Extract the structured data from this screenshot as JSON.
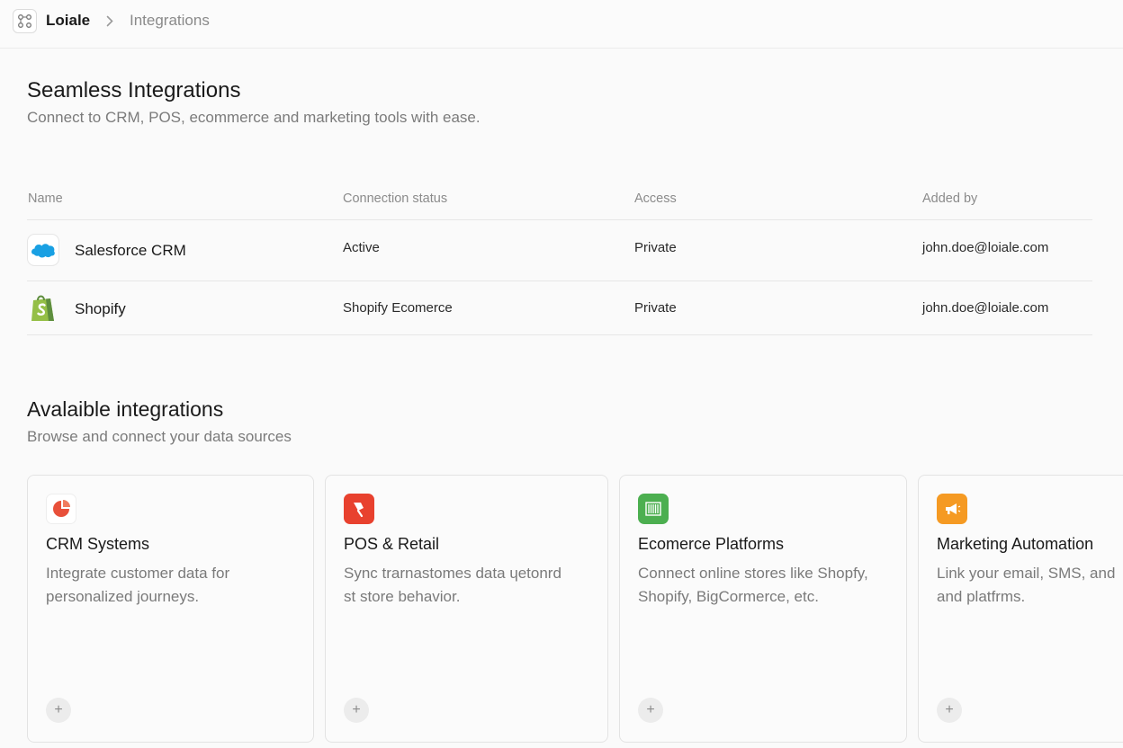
{
  "breadcrumb": {
    "root": "Loiale",
    "current": "Integrations"
  },
  "connected": {
    "title": "Seamless Integrations",
    "subtitle": "Connect to CRM, POS, ecommerce and marketing tools with ease.",
    "columns": [
      "Name",
      "Connection status",
      "Access",
      "Added by"
    ],
    "rows": [
      {
        "name": "Salesforce CRM",
        "logo_text": "salesforce",
        "status": "Active",
        "access": "Private",
        "added_by": "john.doe@loiale.com"
      },
      {
        "name": "Shopify",
        "status": "Shopify Ecomerce",
        "access": "Private",
        "added_by": "john.doe@loiale.com"
      }
    ]
  },
  "available": {
    "title": "Avalaible integrations",
    "subtitle": "Browse and connect your data sources",
    "cards": [
      {
        "title": "CRM Systems",
        "description": "Integrate customer data for\npersonalized journeys.",
        "icon": "chart-icon",
        "color": "#e8503a",
        "add": "+"
      },
      {
        "title": "POS & Retail",
        "description": "Sync trarnastomes data ɥetonrd\nst store behavior.",
        "icon": "pos-icon",
        "color": "#e8412e",
        "add": "+"
      },
      {
        "title": "Ecomerce Platforms",
        "description": "Connect online stores like Shopfy,\nShopify, BigCormerce, etc.",
        "icon": "barcode-icon",
        "color": "#4caf50",
        "add": "+"
      },
      {
        "title": "Marketing Automation",
        "description": "Link your email, SMS, and\nand platfrms.",
        "icon": "megaphone-icon",
        "color": "#f59a23",
        "add": "+"
      }
    ]
  }
}
